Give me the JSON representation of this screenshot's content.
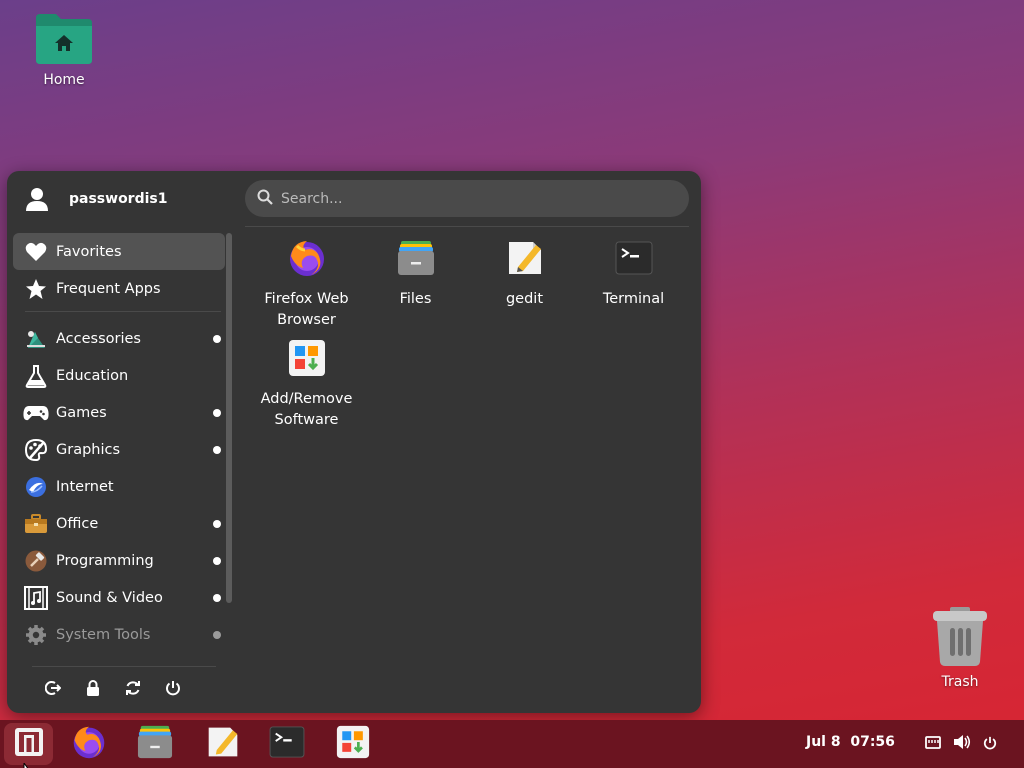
{
  "desktop": {
    "home_label": "Home",
    "trash_label": "Trash"
  },
  "menu": {
    "username": "passwordis1",
    "search_placeholder": "Search...",
    "categories": [
      {
        "label": "Favorites",
        "icon": "heart-icon",
        "active": true,
        "dot": false
      },
      {
        "label": "Frequent Apps",
        "icon": "star-icon",
        "active": false,
        "dot": false
      },
      {
        "label": "Accessories",
        "icon": "accessories-icon",
        "active": false,
        "dot": true
      },
      {
        "label": "Education",
        "icon": "flask-icon",
        "active": false,
        "dot": false
      },
      {
        "label": "Games",
        "icon": "gamepad-icon",
        "active": false,
        "dot": true
      },
      {
        "label": "Graphics",
        "icon": "palette-icon",
        "active": false,
        "dot": true
      },
      {
        "label": "Internet",
        "icon": "globe-icon",
        "active": false,
        "dot": false
      },
      {
        "label": "Office",
        "icon": "briefcase-icon",
        "active": false,
        "dot": true
      },
      {
        "label": "Programming",
        "icon": "hammer-icon",
        "active": false,
        "dot": true
      },
      {
        "label": "Sound & Video",
        "icon": "film-music-icon",
        "active": false,
        "dot": true
      },
      {
        "label": "System Tools",
        "icon": "gear-icon",
        "active": false,
        "dot": true
      }
    ],
    "apps": [
      {
        "label": "Firefox Web Browser",
        "icon": "firefox-icon"
      },
      {
        "label": "Files",
        "icon": "files-icon"
      },
      {
        "label": "gedit",
        "icon": "gedit-icon"
      },
      {
        "label": "Terminal",
        "icon": "terminal-icon"
      },
      {
        "label": "Add/Remove Software",
        "icon": "software-icon"
      }
    ],
    "actions": [
      "logout-icon",
      "lock-icon",
      "switch-user-icon",
      "power-icon"
    ]
  },
  "taskbar": {
    "clock": "Jul 8  07:56",
    "items": [
      "start-menu-icon",
      "firefox-icon",
      "files-icon",
      "gedit-icon",
      "terminal-icon",
      "software-icon"
    ],
    "tray": [
      "network-icon",
      "volume-icon",
      "power-icon"
    ]
  },
  "colors": {
    "menu_bg": "#353535",
    "taskbar_bg": "#6b1420",
    "accent": "#d82432"
  }
}
